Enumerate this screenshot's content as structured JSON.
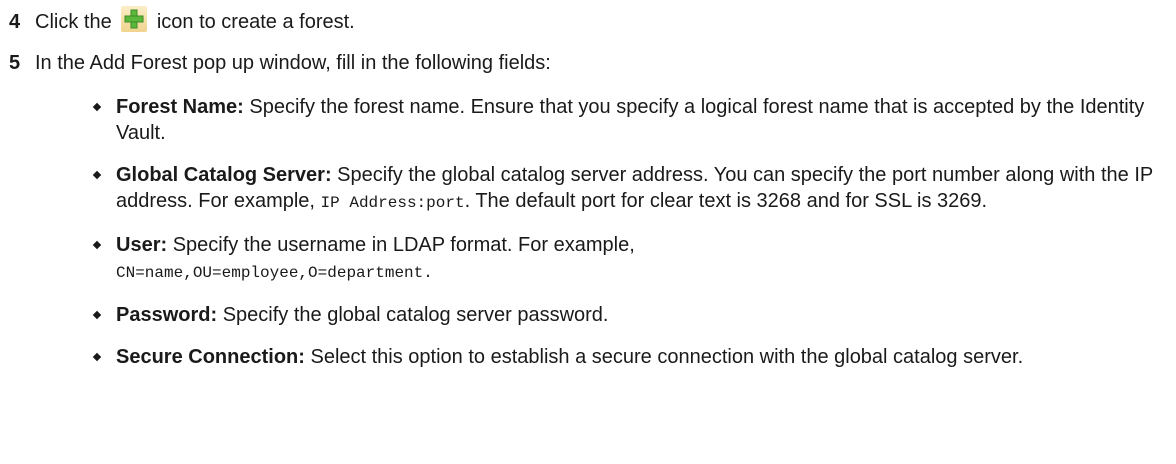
{
  "step4": {
    "number": "4",
    "text_before": "Click the",
    "icon": "green-plus-icon",
    "text_after": "icon to create a forest."
  },
  "step5": {
    "number": "5",
    "text": "In the Add Forest pop up window, fill in the following fields:"
  },
  "fields": [
    {
      "term": "Forest Name:",
      "desc": " Specify the forest name. Ensure that you specify a logical forest name that is accepted by the Identity Vault."
    },
    {
      "term": "Global Catalog Server:",
      "desc_before": "  Specify the global catalog server address. You can specify the port number along with the IP address. For example, ",
      "code": "IP Address:port",
      "desc_after": ". The default port for clear text is 3268 and for SSL is 3269."
    },
    {
      "term": "User:",
      "desc": "  Specify the username in LDAP format. For example,",
      "code": "CN=name,OU=employee,O=department."
    },
    {
      "term": "Password:",
      "desc": "  Specify the global catalog server password."
    },
    {
      "term": "Secure Connection:",
      "desc": "  Select this option to establish a secure connection with the global catalog server."
    }
  ],
  "colors": {
    "icon_bg": "#f0d48e",
    "icon_plus": "#5cb83a"
  }
}
